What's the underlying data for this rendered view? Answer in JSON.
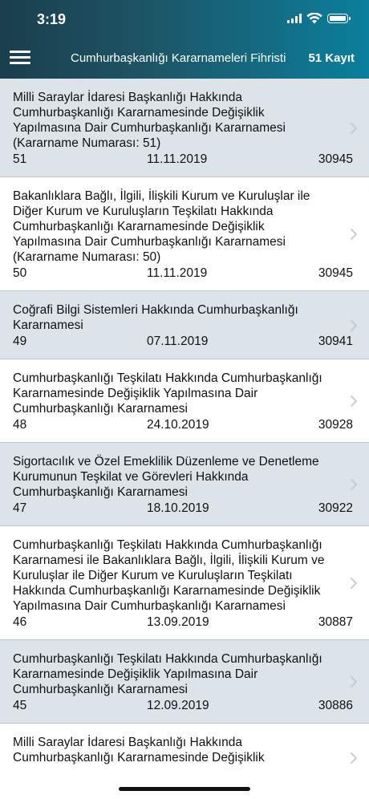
{
  "status_bar": {
    "time": "3:19"
  },
  "nav": {
    "title": "Cumhurbaşkanlığı Kararnameleri Fihristi",
    "count": "51 Kayıt",
    "menu_icon": "hamburger-menu-icon"
  },
  "items": [
    {
      "title": "Milli Saraylar İdaresi Başkanlığı Hakkında Cumhurbaşkanlığı Kararnamesinde Değişiklik Yapılmasına Dair Cumhurbaşkanlığı Kararnamesi (Kararname Numarası: 51)",
      "number": "51",
      "date": "11.11.2019",
      "rg": "30945"
    },
    {
      "title": "Bakanlıklara Bağlı, İlgili, İlişkili Kurum ve Kuruluşlar ile Diğer Kurum ve Kuruluşların Teşkilatı Hakkında Cumhurbaşkanlığı Kararnamesinde Değişiklik Yapılmasına Dair Cumhurbaşkanlığı Kararnamesi (Kararname Numarası: 50)",
      "number": "50",
      "date": "11.11.2019",
      "rg": "30945"
    },
    {
      "title": "Coğrafi Bilgi Sistemleri Hakkında Cumhurbaşkanlığı Kararnamesi",
      "number": "49",
      "date": "07.11.2019",
      "rg": "30941"
    },
    {
      "title": "Cumhurbaşkanlığı Teşkilatı Hakkında Cumhurbaşkanlığı Kararnamesinde Değişiklik Yapılmasına Dair Cumhurbaşkanlığı Kararnamesi",
      "number": "48",
      "date": "24.10.2019",
      "rg": "30928"
    },
    {
      "title": "Sigortacılık ve Özel Emeklilik Düzenleme ve Denetleme Kurumunun Teşkilat ve Görevleri Hakkında Cumhurbaşkanlığı Kararnamesi",
      "number": "47",
      "date": "18.10.2019",
      "rg": "30922"
    },
    {
      "title": "Cumhurbaşkanlığı Teşkilatı Hakkında Cumhurbaşkanlığı Kararnamesi ile Bakanlıklara Bağlı, İlgili, İlişkili Kurum ve Kuruluşlar ile Diğer Kurum ve Kuruluşların Teşkilatı Hakkında Cumhurbaşkanlığı Kararnamesinde Değişiklik Yapılmasına Dair Cumhurbaşkanlığı Kararnamesi",
      "number": "46",
      "date": "13.09.2019",
      "rg": "30887"
    },
    {
      "title": "Cumhurbaşkanlığı Teşkilatı Hakkında Cumhurbaşkanlığı Kararnamesinde Değişiklik Yapılmasına Dair Cumhurbaşkanlığı Kararnamesi",
      "number": "45",
      "date": "12.09.2019",
      "rg": "30886"
    },
    {
      "title": "Milli Saraylar İdaresi Başkanlığı Hakkında Cumhurbaşkanlığı Kararnamesinde Değişiklik",
      "number": "",
      "date": "",
      "rg": ""
    }
  ]
}
